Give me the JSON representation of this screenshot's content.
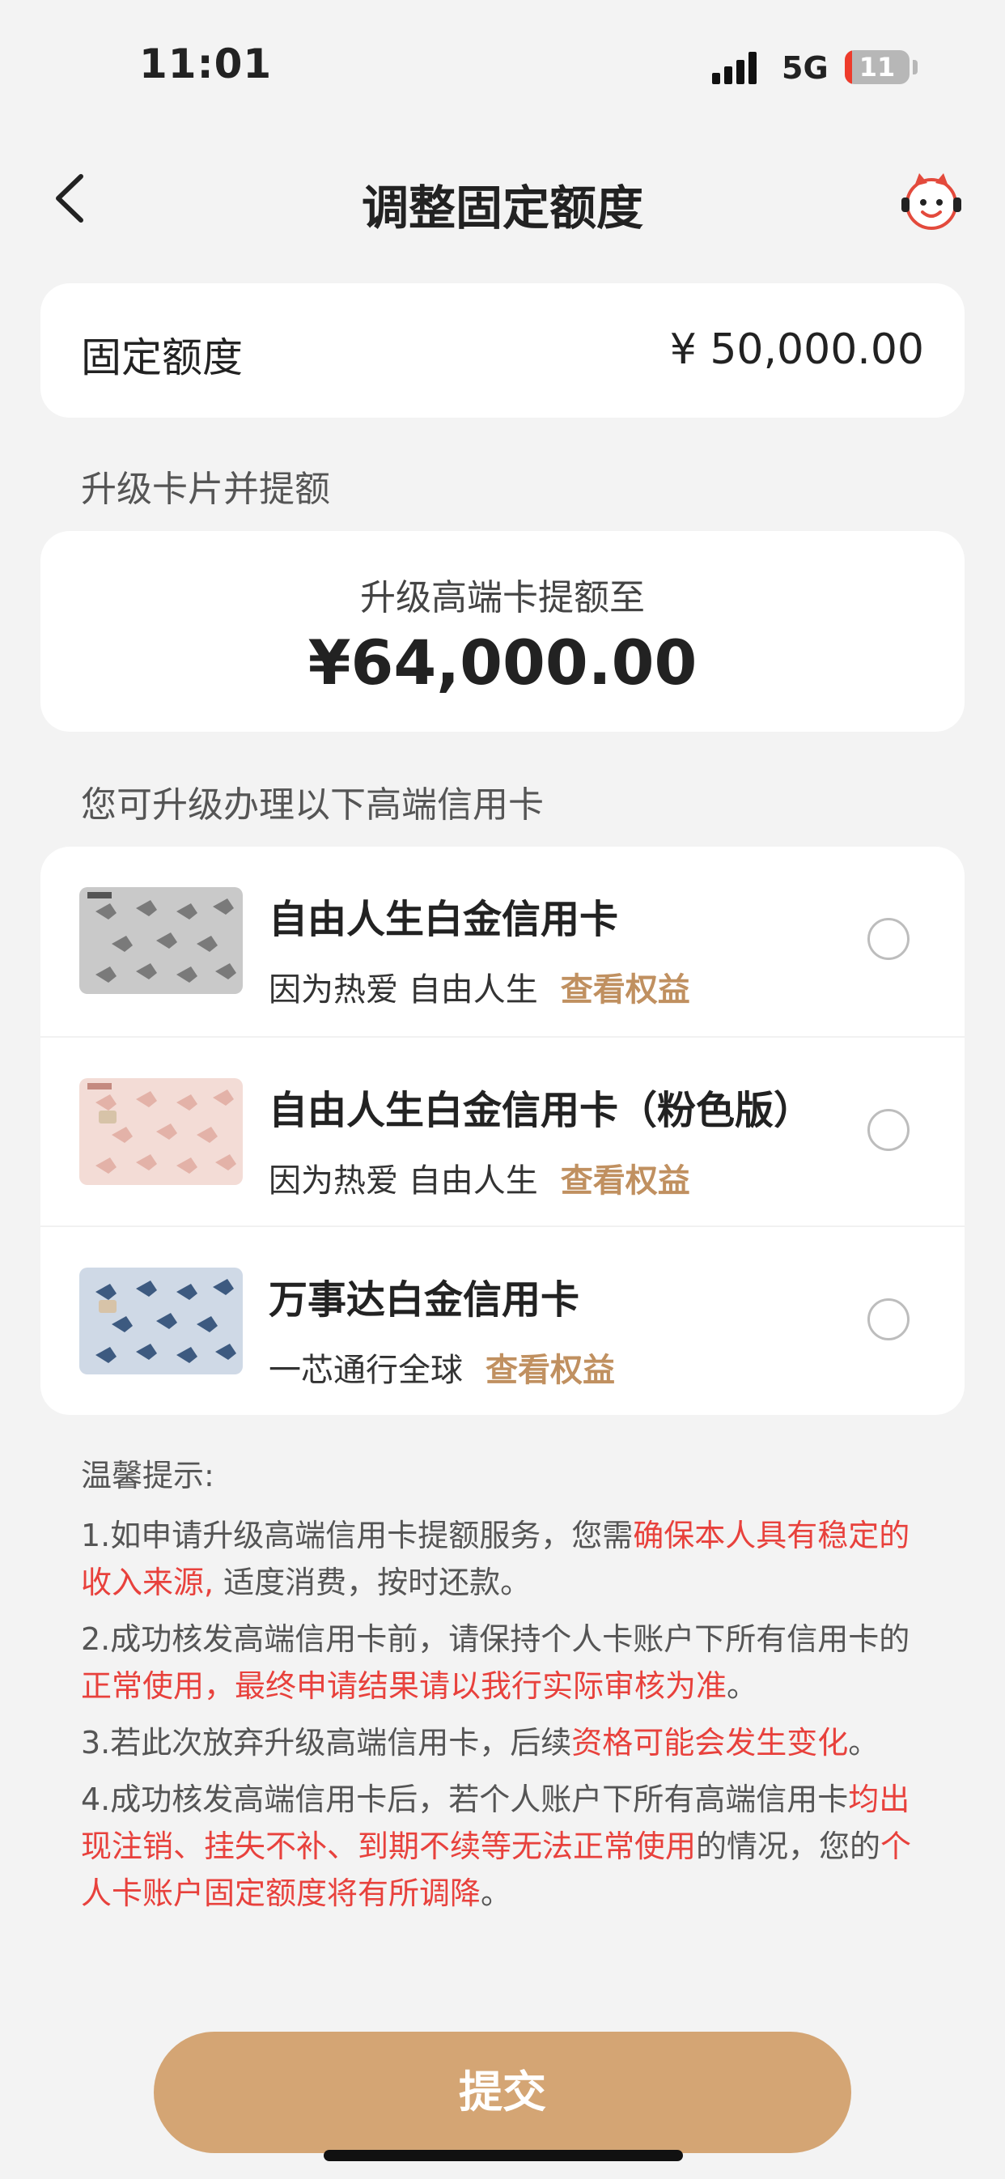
{
  "status_bar": {
    "time": "11:01",
    "network": "5G",
    "battery": "11"
  },
  "header": {
    "title": "调整固定额度"
  },
  "quota": {
    "label": "固定额度",
    "value": "¥ 50,000.00"
  },
  "upgrade_section": {
    "label": "升级卡片并提额"
  },
  "upgrade": {
    "subtitle": "升级高端卡提额至",
    "amount": "¥64,000.00"
  },
  "cards_section": {
    "label": "您可升级办理以下高端信用卡"
  },
  "cards": [
    {
      "name": "自由人生白金信用卡",
      "slogan": "因为热爱 自由人生",
      "link": "查看权益"
    },
    {
      "name": "自由人生白金信用卡（粉色版）",
      "slogan": "因为热爱 自由人生",
      "link": "查看权益"
    },
    {
      "name": "万事达白金信用卡",
      "slogan": "一芯通行全球",
      "link": "查看权益"
    }
  ],
  "tips": {
    "title": "温馨提示:",
    "t1a": "1.如申请升级高端信用卡提额服务，您需",
    "t1b": "确保本人具有稳定的收入来源,",
    "t1c": " 适度消费，按时还款。",
    "t2a": "2.成功核发高端信用卡前，请保持个人卡账户下所有信用卡的",
    "t2b": "正常使用，最终申请结果请以我行实际审核为准",
    "t2c": "。",
    "t3a": "3.若此次放弃升级高端信用卡，后续",
    "t3b": "资格可能会发生变化",
    "t3c": "。",
    "t4a": "4.成功核发高端信用卡后，若个人账户下所有高端信用卡",
    "t4b": "均出现注销、挂失不补、到期不续等无法正常使用",
    "t4c": "的情况，您的",
    "t4d": "个人卡账户固定额度将有所调降",
    "t4e": "。"
  },
  "submit": {
    "label": "提交"
  },
  "colors": {
    "accent": "#d4a574",
    "link": "#c09060",
    "warning": "#e8413c"
  }
}
